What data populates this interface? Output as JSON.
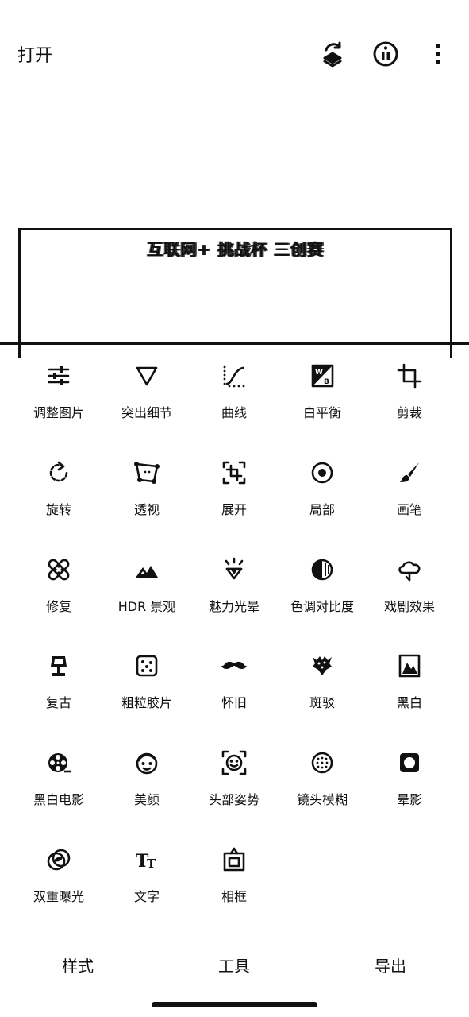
{
  "header": {
    "open_label": "打开",
    "icons": [
      "undo-history-icon",
      "info-icon",
      "more-options-icon"
    ]
  },
  "preview": {
    "caption": "互联网+ 挑战杯 三创赛"
  },
  "tools": [
    {
      "label": "调整图片",
      "icon": "tune-sliders-icon"
    },
    {
      "label": "突出细节",
      "icon": "details-triangle-icon"
    },
    {
      "label": "曲线",
      "icon": "curves-icon"
    },
    {
      "label": "白平衡",
      "icon": "white-balance-icon"
    },
    {
      "label": "剪裁",
      "icon": "crop-icon"
    },
    {
      "label": "旋转",
      "icon": "rotate-icon"
    },
    {
      "label": "透视",
      "icon": "perspective-icon"
    },
    {
      "label": "展开",
      "icon": "expand-icon"
    },
    {
      "label": "局部",
      "icon": "selective-icon"
    },
    {
      "label": "画笔",
      "icon": "brush-icon"
    },
    {
      "label": "修复",
      "icon": "healing-icon"
    },
    {
      "label": "HDR 景观",
      "icon": "hdr-landscape-icon"
    },
    {
      "label": "魅力光晕",
      "icon": "glamour-glow-icon"
    },
    {
      "label": "色调对比度",
      "icon": "tonal-contrast-icon"
    },
    {
      "label": "戏剧效果",
      "icon": "drama-icon"
    },
    {
      "label": "复古",
      "icon": "vintage-lamp-icon"
    },
    {
      "label": "粗粒胶片",
      "icon": "grainy-film-icon"
    },
    {
      "label": "怀旧",
      "icon": "retrolux-mustache-icon"
    },
    {
      "label": "斑驳",
      "icon": "grunge-icon"
    },
    {
      "label": "黑白",
      "icon": "black-white-icon"
    },
    {
      "label": "黑白电影",
      "icon": "noir-film-reel-icon"
    },
    {
      "label": "美颜",
      "icon": "face-enhance-icon"
    },
    {
      "label": "头部姿势",
      "icon": "head-pose-icon"
    },
    {
      "label": "镜头模糊",
      "icon": "lens-blur-icon"
    },
    {
      "label": "晕影",
      "icon": "vignette-icon"
    },
    {
      "label": "双重曝光",
      "icon": "double-exposure-icon"
    },
    {
      "label": "文字",
      "icon": "text-icon"
    },
    {
      "label": "相框",
      "icon": "frame-icon"
    }
  ],
  "bottom_nav": {
    "styles_label": "样式",
    "tools_label": "工具",
    "export_label": "导出"
  }
}
